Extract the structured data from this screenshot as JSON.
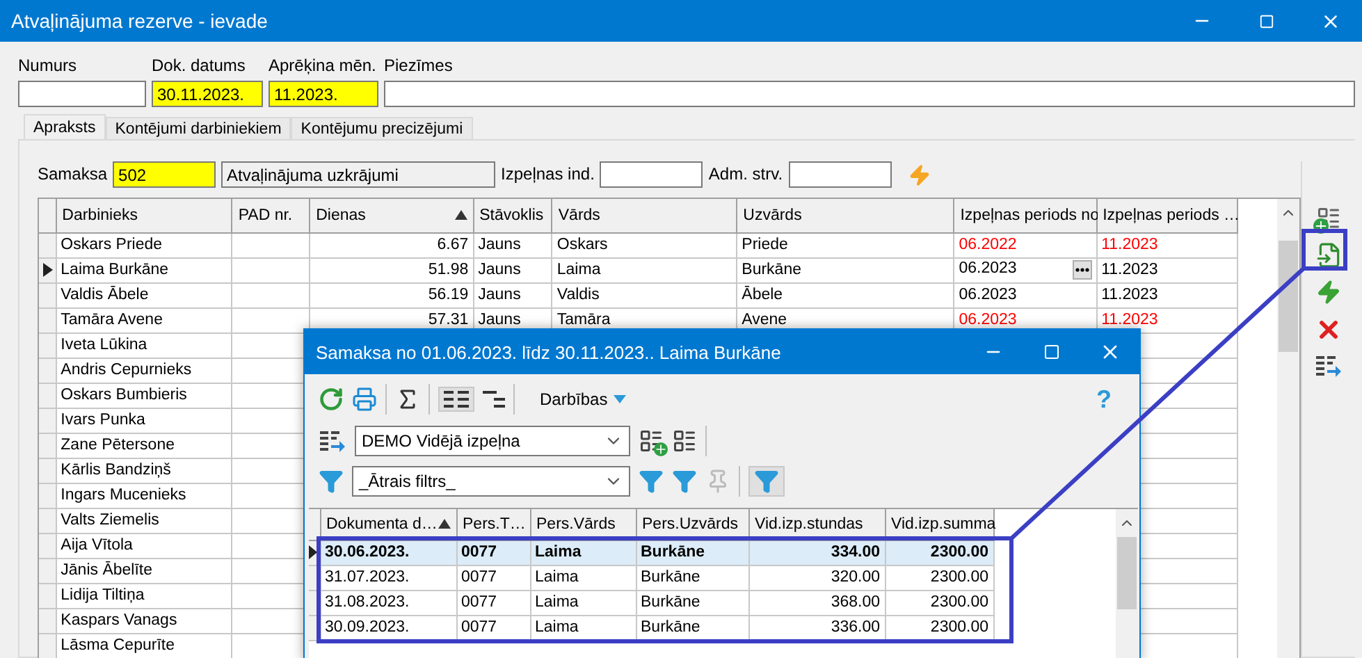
{
  "window": {
    "title": "Atvaļinājuma rezerve - ievade"
  },
  "form": {
    "fields": [
      {
        "label": "Numurs",
        "required": false
      },
      {
        "label": "Dok. datums",
        "value": "30.11.2023.",
        "required": true
      },
      {
        "label": "Aprēķina mēn.",
        "value": "11.2023.",
        "required": true
      },
      {
        "label": "Piezīmes",
        "required": false
      }
    ]
  },
  "tabs": [
    {
      "label": "Apraksts",
      "selected": true
    },
    {
      "label": "Kontējumi darbiniekiem",
      "selected": false
    },
    {
      "label": "Kontējumu precizējumi",
      "selected": false
    }
  ],
  "payment": {
    "label": "Samaksa",
    "code": "502",
    "code_required": true,
    "name": "Atvaļinājuma uzkrājumi",
    "earning_label": "Izpeļnas ind.",
    "admin_label": "Adm. strv."
  },
  "grid": {
    "columns": [
      {
        "label": "Darbinieks",
        "sorted": false
      },
      {
        "label": "PAD nr.",
        "sorted": false
      },
      {
        "label": "Dienas",
        "sorted": true
      },
      {
        "label": "Stāvoklis",
        "sorted": false
      },
      {
        "label": "Vārds",
        "sorted": false
      },
      {
        "label": "Uzvārds",
        "sorted": false
      },
      {
        "label": "Izpeļnas periods no",
        "sorted": false
      },
      {
        "label": "Izpeļnas periods …",
        "sorted": false
      }
    ],
    "rows": [
      {
        "name": "Oskars Priede",
        "days": "6.67",
        "status": "Jauns",
        "first": "Oskars",
        "last": "Priede",
        "from": "06.2022",
        "to": "11.2023",
        "warning": true,
        "current": false
      },
      {
        "name": "Laima Burkāne",
        "days": "51.98",
        "status": "Jauns",
        "first": "Laima",
        "last": "Burkāne",
        "from": "06.2023",
        "to": "11.2023",
        "warning": false,
        "current": true
      },
      {
        "name": "Valdis Ābele",
        "days": "56.19",
        "status": "Jauns",
        "first": "Valdis",
        "last": "Ābele",
        "from": "06.2023",
        "to": "11.2023",
        "warning": false,
        "current": false
      },
      {
        "name": "Tamāra Avene",
        "days": "57.31",
        "status": "Jauns",
        "first": "Tamāra",
        "last": "Avene",
        "from": "06.2023",
        "to": "11.2023",
        "warning": true,
        "current": false
      },
      {
        "name": "Iveta Lūkina",
        "current": false
      },
      {
        "name": "Andris Cepurnieks",
        "current": false
      },
      {
        "name": "Oskars Bumbieris",
        "current": false
      },
      {
        "name": "Ivars Punka",
        "current": false
      },
      {
        "name": "Zane Pētersone",
        "current": false
      },
      {
        "name": "Kārlis Bandziņš",
        "current": false
      },
      {
        "name": "Ingars Mucenieks",
        "current": false
      },
      {
        "name": "Valts Ziemelis",
        "current": false
      },
      {
        "name": "Aija Vītola",
        "current": false
      },
      {
        "name": "Jānis Ābelīte",
        "current": false
      },
      {
        "name": "Lidija Tiltiņa",
        "current": false
      },
      {
        "name": "Kaspars  Vanags",
        "current": false
      },
      {
        "name": "Lāsma Cepurīte",
        "current": false
      }
    ]
  },
  "dialog": {
    "title": "Samaksa no 01.06.2023. līdz 30.11.2023.. Laima Burkāne",
    "actions": "Darbības",
    "help": "?",
    "layout": "DEMO Vidējā izpeļna",
    "filter": "_Ātrais filtrs_",
    "grid": {
      "columns": [
        {
          "label": "Dokumenta d…",
          "sorted": true
        },
        {
          "label": "Pers.T…",
          "sorted": false
        },
        {
          "label": "Pers.Vārds",
          "sorted": false
        },
        {
          "label": "Pers.Uzvārds",
          "sorted": false
        },
        {
          "label": "Vid.izp.stundas",
          "sorted": false
        },
        {
          "label": "Vid.izp.summa",
          "sorted": false
        }
      ],
      "rows": [
        {
          "date": "30.06.2023.",
          "code": "0077",
          "first": "Laima",
          "last": "Burkāne",
          "hours": "334.00",
          "sum": "2300.00",
          "selected": true
        },
        {
          "date": "31.07.2023.",
          "code": "0077",
          "first": "Laima",
          "last": "Burkāne",
          "hours": "320.00",
          "sum": "2300.00",
          "selected": false
        },
        {
          "date": "31.08.2023.",
          "code": "0077",
          "first": "Laima",
          "last": "Burkāne",
          "hours": "368.00",
          "sum": "2300.00",
          "selected": false
        },
        {
          "date": "30.09.2023.",
          "code": "0077",
          "first": "Laima",
          "last": "Burkāne",
          "hours": "336.00",
          "sum": "2300.00",
          "selected": false
        }
      ]
    }
  }
}
